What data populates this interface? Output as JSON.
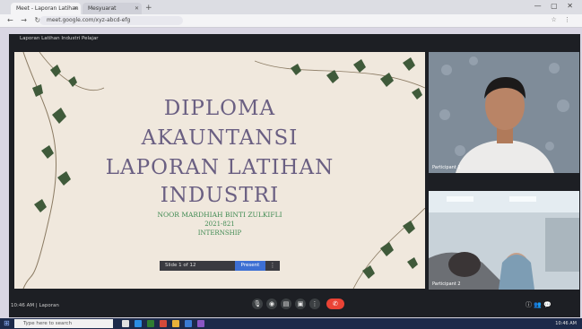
{
  "browser": {
    "tabs": [
      {
        "label": "Meet - Laporan Latihan",
        "active": true
      },
      {
        "label": "Mesyuarat",
        "active": false
      }
    ],
    "new_tab": "+",
    "window_controls": "— ▢ ✕",
    "nav": "← → ↻",
    "url": "meet.google.com/xyz-abcd-efg",
    "addr_icons": "☆ ⋮"
  },
  "meeting": {
    "title": "Laporan Latihan Industri Pelajar"
  },
  "slide": {
    "title_lines": [
      "DIPLOMA",
      "AKAUNTANSI",
      "LAPORAN LATIHAN",
      "INDUSTRI"
    ],
    "subtitle_lines": [
      "NOOR MARDHIAH BINTI ZULKIFLI",
      "2021-821",
      "INTERNSHIP"
    ],
    "toolbar": {
      "page": "Slide 1 of 12",
      "present": "Present",
      "more": "⋮"
    },
    "colors": {
      "background": "#f0e8dd",
      "title": "#6a5f82",
      "subtitle": "#3f8a52",
      "leaf": "#3f5a3a"
    }
  },
  "participants": [
    {
      "name": "Participant 1"
    },
    {
      "name": "Participant 2"
    }
  ],
  "controls": {
    "meeting_info": "10:46 AM | Laporan",
    "buttons": [
      "mic-icon",
      "camera-icon",
      "captions-icon",
      "present-icon",
      "more-icon"
    ],
    "end": "end-call-icon",
    "right": "ⓘ 👥 💬"
  },
  "taskbar": {
    "search_placeholder": "Type here to search",
    "tray_time": "10:46 AM",
    "app_colors": [
      "#e0e0e0",
      "#2a8de3",
      "#2f7d32",
      "#d34a3a",
      "#e8b13a",
      "#3a7bd5",
      "#8a56c4"
    ]
  }
}
